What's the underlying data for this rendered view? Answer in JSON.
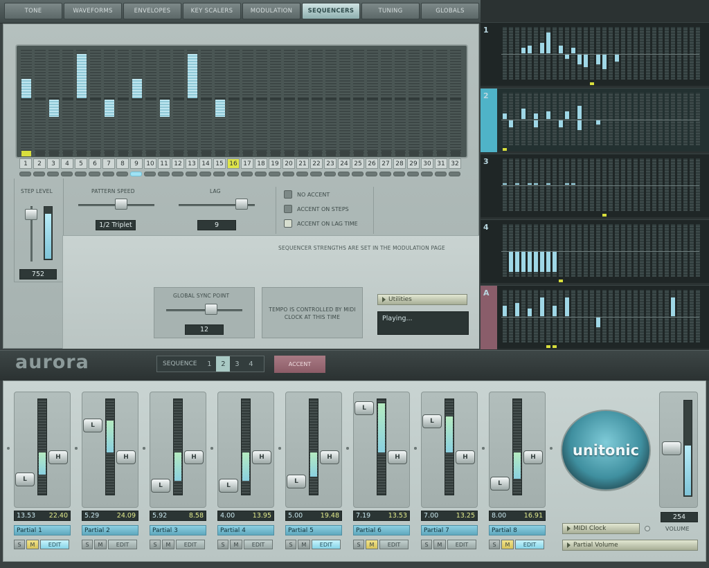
{
  "tabs": [
    "TONE",
    "WAVEFORMS",
    "ENVELOPES",
    "KEY SCALERS",
    "MODULATION",
    "SEQUENCERS",
    "TUNING",
    "GLOBALS"
  ],
  "active_tab": 5,
  "steps": {
    "numbers": [
      "1",
      "2",
      "3",
      "4",
      "5",
      "6",
      "7",
      "8",
      "9",
      "10",
      "11",
      "12",
      "13",
      "14",
      "15",
      "16",
      "17",
      "18",
      "19",
      "20",
      "21",
      "22",
      "23",
      "24",
      "25",
      "26",
      "27",
      "28",
      "29",
      "30",
      "31",
      "32"
    ],
    "levels": [
      0.7,
      0.5,
      0.32,
      0.5,
      0.96,
      0.5,
      0.32,
      0.5,
      0.7,
      0.5,
      0.32,
      0.5,
      0.96,
      0.5,
      0.32,
      0.5,
      0.5,
      0.5,
      0.5,
      0.5,
      0.5,
      0.5,
      0.5,
      0.5,
      0.5,
      0.5,
      0.5,
      0.5,
      0.5,
      0.5,
      0.5,
      0.5
    ],
    "current_step": 16,
    "active_led": 9
  },
  "controls": {
    "step_level_label": "STEP LEVEL",
    "step_level_value": "752",
    "step_level_fill": 0.85,
    "pattern_speed_label": "PATTERN SPEED",
    "pattern_speed_value": "1/2 Triplet",
    "lag_label": "LAG",
    "lag_value": "9",
    "no_accent": "NO ACCENT",
    "accent_on_steps": "ACCENT ON STEPS",
    "accent_on_lag": "ACCENT ON LAG TIME",
    "strengths_note": "SEQUENCER STRENGTHS ARE SET IN THE MODULATION PAGE",
    "sync_label": "GLOBAL SYNC POINT",
    "sync_value": "12",
    "tempo_note": "TEMPO IS CONTROLLED BY MIDI CLOCK AT THIS TIME",
    "utilities": "Utilities",
    "status": "Playing..."
  },
  "preview": [
    {
      "label": "1",
      "selected": false
    },
    {
      "label": "2",
      "selected": true
    },
    {
      "label": "3",
      "selected": false
    },
    {
      "label": "4",
      "selected": false
    },
    {
      "label": "A",
      "selected": false
    }
  ],
  "sequence_bar": {
    "label": "SEQUENCE",
    "items": [
      "1",
      "2",
      "3",
      "4"
    ],
    "selected": 1,
    "accent": "ACCENT"
  },
  "brand": "aurora",
  "logo": "unitonic",
  "partials": [
    {
      "name": "Partial 1",
      "lo": "13.53",
      "hi": "22.40",
      "l": 0.22,
      "h": 0.45,
      "m": true,
      "edit": true
    },
    {
      "name": "Partial 2",
      "lo": "5.29",
      "hi": "24.09",
      "l": 0.78,
      "h": 0.45,
      "m": false,
      "edit": false
    },
    {
      "name": "Partial 3",
      "lo": "5.92",
      "hi": "8.58",
      "l": 0.16,
      "h": 0.45,
      "m": false,
      "edit": false
    },
    {
      "name": "Partial 4",
      "lo": "4.00",
      "hi": "13.95",
      "l": 0.16,
      "h": 0.45,
      "m": false,
      "edit": false
    },
    {
      "name": "Partial 5",
      "lo": "5.00",
      "hi": "19.48",
      "l": 0.2,
      "h": 0.45,
      "m": false,
      "edit": true
    },
    {
      "name": "Partial 6",
      "lo": "7.19",
      "hi": "13.53",
      "l": 0.96,
      "h": 0.45,
      "m": true,
      "edit": false
    },
    {
      "name": "Partial 7",
      "lo": "7.00",
      "hi": "13.25",
      "l": 0.82,
      "h": 0.45,
      "m": false,
      "edit": false
    },
    {
      "name": "Partial 8",
      "lo": "8.00",
      "hi": "16.91",
      "l": 0.18,
      "h": 0.45,
      "m": true,
      "edit": true
    }
  ],
  "button_labels": {
    "s": "S",
    "m": "M",
    "edit": "EDIT",
    "l": "L",
    "h": "H"
  },
  "volume": {
    "label": "VOLUME",
    "value": "254",
    "fill": 0.52
  },
  "midi_clock": "MIDI Clock",
  "partial_volume": "Partial Volume"
}
